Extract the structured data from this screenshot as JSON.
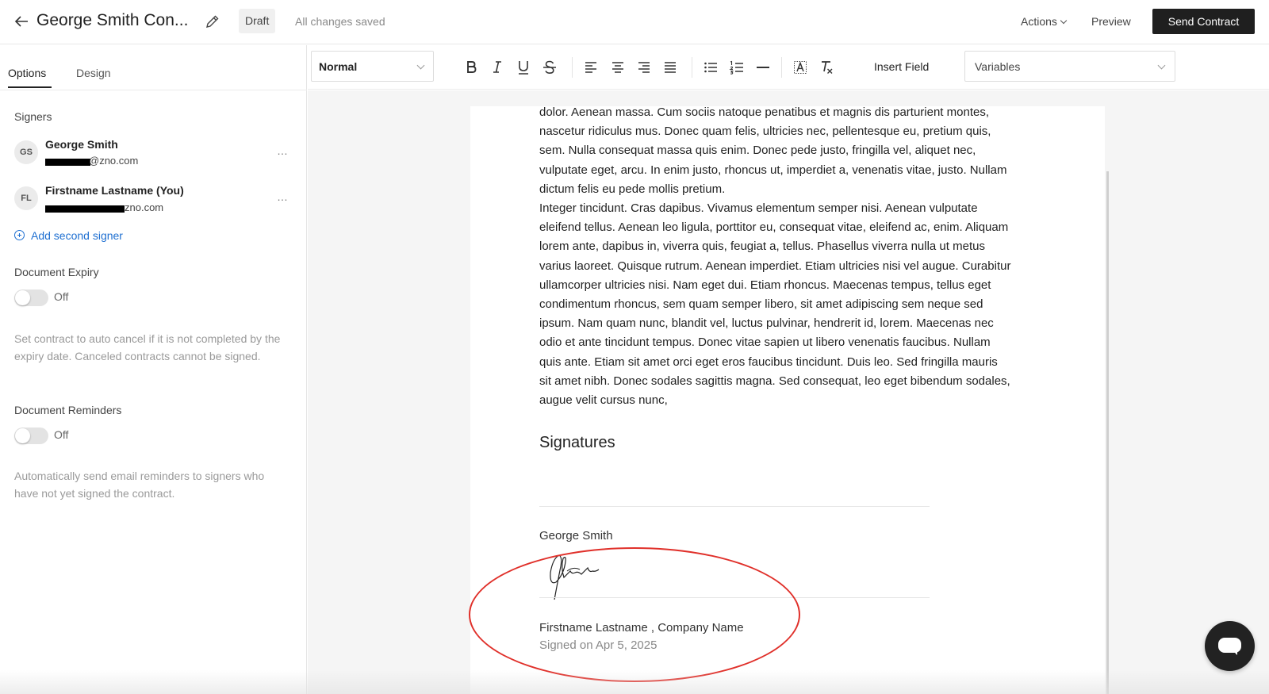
{
  "header": {
    "title": "George Smith Con...",
    "status_badge": "Draft",
    "save_status": "All changes saved",
    "actions_label": "Actions",
    "preview_label": "Preview",
    "send_label": "Send Contract"
  },
  "sidebar": {
    "tabs": [
      {
        "label": "Options",
        "active": true
      },
      {
        "label": "Design",
        "active": false
      }
    ],
    "signers_heading": "Signers",
    "signers": [
      {
        "initials": "GS",
        "name": "George Smith",
        "email_suffix": "@zno.com"
      },
      {
        "initials": "FL",
        "name": "Firstname Lastname (You)",
        "email_suffix": "zno.com"
      }
    ],
    "more_icon": "…",
    "add_signer_label": "Add second signer",
    "expiry": {
      "label": "Document Expiry",
      "state": "Off",
      "help": "Set contract to auto cancel if it is not completed by the expiry date. Canceled contracts cannot be signed."
    },
    "reminders": {
      "label": "Document Reminders",
      "state": "Off",
      "help": "Automatically send email reminders to signers who have not yet signed the contract."
    }
  },
  "toolbar": {
    "style_select": "Normal",
    "insert_field_label": "Insert Field",
    "variables_select": "Variables",
    "icons": [
      "bold-icon",
      "italic-icon",
      "underline-icon",
      "strikethrough-icon",
      "align-left-icon",
      "align-center-icon",
      "align-right-icon",
      "align-justify-icon",
      "bullet-list-icon",
      "numbered-list-icon",
      "horizontal-rule-icon",
      "highlight-icon",
      "clear-format-icon"
    ]
  },
  "document": {
    "lines": [
      "dolor. Aenean massa. Cum sociis natoque penatibus et magnis dis parturient montes,",
      "nascetur ridiculus mus. Donec quam felis, ultricies nec, pellentesque eu, pretium quis,",
      "sem. Nulla consequat massa quis enim. Donec pede justo, fringilla vel, aliquet nec,",
      "vulputate eget, arcu. In enim justo, rhoncus ut, imperdiet a, venenatis vitae, justo. Nullam",
      "dictum felis eu pede mollis pretium.",
      "Integer tincidunt. Cras dapibus. Vivamus elementum semper nisi. Aenean vulputate",
      "eleifend tellus. Aenean leo ligula, porttitor eu, consequat vitae, eleifend ac, enim. Aliquam",
      "lorem ante, dapibus in, viverra quis, feugiat a, tellus. Phasellus viverra nulla ut metus",
      "varius laoreet. Quisque rutrum. Aenean imperdiet. Etiam ultricies nisi vel augue. Curabitur",
      "ullamcorper ultricies nisi. Nam eget dui. Etiam rhoncus. Maecenas tempus, tellus eget",
      "condimentum rhoncus, sem quam semper libero, sit amet adipiscing sem neque sed",
      "ipsum. Nam quam nunc, blandit vel, luctus pulvinar, hendrerit id, lorem. Maecenas nec",
      "odio et ante tincidunt tempus. Donec vitae sapien ut libero venenatis faucibus. Nullam",
      "quis ante. Etiam sit amet orci eget eros faucibus tincidunt. Duis leo. Sed fringilla mauris",
      "sit amet nibh. Donec sodales sagittis magna. Sed consequat, leo eget bibendum sodales,",
      "augue velit cursus nunc,"
    ],
    "signatures_heading": "Signatures",
    "signature_block": {
      "signer_name": "George Smith",
      "signed_by": "Firstname Lastname , Company Name",
      "signed_date": "Signed on Apr 5, 2025"
    }
  },
  "colors": {
    "accent_link": "#1e6fd1",
    "annotation_red": "#e0302a",
    "primary_button": "#1f1f1f"
  }
}
